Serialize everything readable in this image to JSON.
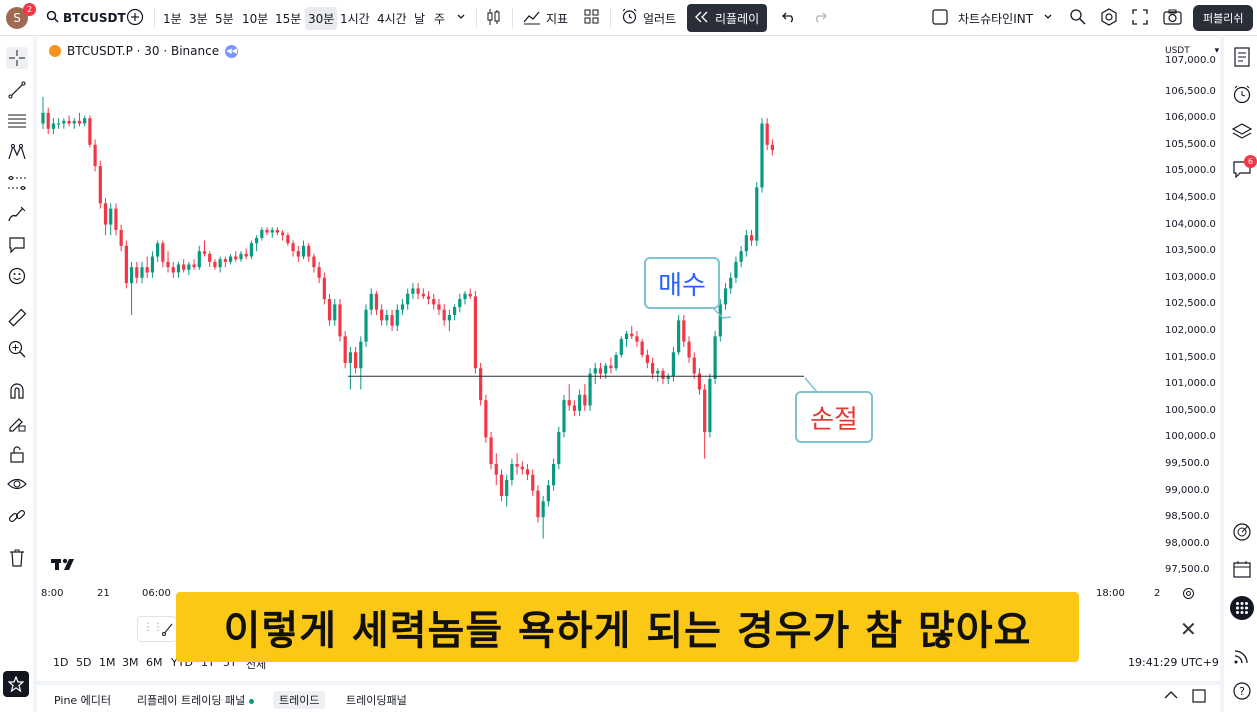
{
  "topbar": {
    "avatar_letter": "S",
    "avatar_badge": "2",
    "symbol": "BTCUSDT",
    "intervals": [
      "1분",
      "3분",
      "5분",
      "10분",
      "15분",
      "30분",
      "1시간",
      "4시간",
      "날",
      "주"
    ],
    "active_interval": "30분",
    "indicators_label": "지표",
    "alert_label": "얼러트",
    "replay_label": "리플레이",
    "layout_name": "차트슈타인INT",
    "publish_label": "퍼블리쉬"
  },
  "legend": {
    "title": "BTCUSDT.P · 30 · Binance"
  },
  "price_axis": {
    "currency": "USDT",
    "labels": [
      "107,000.0",
      "106,500.0",
      "106,000.0",
      "105,500.0",
      "105,000.0",
      "104,500.0",
      "104,000.0",
      "103,500.0",
      "103,000.0",
      "102,500.0",
      "102,000.0",
      "101,500.0",
      "101,000.0",
      "100,500.0",
      "100,000.0",
      "99,500.0",
      "99,000.0",
      "98,500.0",
      "98,000.0",
      "97,500.0"
    ]
  },
  "time_axis": {
    "labels": [
      "8:00",
      "21",
      "06:00",
      "18:00",
      "2"
    ]
  },
  "range_bar": {
    "ranges": [
      "1D",
      "5D",
      "1M",
      "3M",
      "6M",
      "YTD",
      "1Y",
      "5Y",
      "전체"
    ],
    "clock": "19:41:29 UTC+9"
  },
  "bottom_tabs": [
    "Pine 에디터",
    "리플레이 트레이딩 패널",
    "트레이드",
    "트레이딩패널"
  ],
  "right_badge": "6",
  "annotations": {
    "buy": "매수",
    "stop": "손절"
  },
  "subtitle": "이렇게 세력놈들 욕하게 되는 경우가 참 많아요",
  "colors": {
    "up": "#089981",
    "down": "#f23645",
    "subtitle_bg": "#fbc816",
    "buy_text": "#2962ff",
    "stop_text": "#e53935"
  },
  "chart_data": {
    "type": "candlestick",
    "title": "BTCUSDT.P · 30 · Binance",
    "ylim": [
      97300,
      107000
    ],
    "horizontal_line": 101150,
    "ohlc": [
      [
        105900,
        106400,
        105800,
        106100
      ],
      [
        106100,
        106200,
        105700,
        105800
      ],
      [
        105800,
        106000,
        105700,
        105900
      ],
      [
        105900,
        106000,
        105800,
        105900
      ],
      [
        105900,
        106000,
        105800,
        105950
      ],
      [
        105950,
        106050,
        105850,
        105900
      ],
      [
        105900,
        106000,
        105800,
        105950
      ],
      [
        105950,
        106100,
        105850,
        105900
      ],
      [
        105900,
        106050,
        105850,
        106000
      ],
      [
        106000,
        106050,
        105450,
        105500
      ],
      [
        105500,
        105600,
        105000,
        105100
      ],
      [
        105100,
        105200,
        104300,
        104400
      ],
      [
        104400,
        104500,
        103800,
        104000
      ],
      [
        104000,
        104400,
        103800,
        104300
      ],
      [
        104300,
        104400,
        103800,
        103900
      ],
      [
        103900,
        104000,
        103500,
        103600
      ],
      [
        103600,
        103700,
        102800,
        102900
      ],
      [
        102900,
        103300,
        102300,
        103200
      ],
      [
        103200,
        103300,
        102900,
        103000
      ],
      [
        103000,
        103300,
        102900,
        103200
      ],
      [
        103200,
        103400,
        103000,
        103100
      ],
      [
        103100,
        103500,
        103000,
        103400
      ],
      [
        103400,
        103700,
        103300,
        103650
      ],
      [
        103650,
        103700,
        103200,
        103300
      ],
      [
        103300,
        103500,
        103100,
        103200
      ],
      [
        103200,
        103300,
        103000,
        103100
      ],
      [
        103100,
        103300,
        103000,
        103250
      ],
      [
        103250,
        103350,
        103100,
        103150
      ],
      [
        103150,
        103300,
        103050,
        103250
      ],
      [
        103250,
        103350,
        103150,
        103200
      ],
      [
        103200,
        103600,
        103150,
        103500
      ],
      [
        103500,
        103700,
        103400,
        103450
      ],
      [
        103450,
        103500,
        103200,
        103300
      ],
      [
        103300,
        103350,
        103150,
        103200
      ],
      [
        103200,
        103400,
        103100,
        103350
      ],
      [
        103350,
        103400,
        103200,
        103300
      ],
      [
        103300,
        103450,
        103250,
        103400
      ],
      [
        103400,
        103500,
        103300,
        103350
      ],
      [
        103350,
        103500,
        103300,
        103450
      ],
      [
        103450,
        103550,
        103350,
        103400
      ],
      [
        103400,
        103700,
        103350,
        103650
      ],
      [
        103650,
        103800,
        103500,
        103750
      ],
      [
        103750,
        103950,
        103700,
        103900
      ],
      [
        103900,
        103950,
        103800,
        103850
      ],
      [
        103850,
        103950,
        103750,
        103900
      ],
      [
        103900,
        103950,
        103800,
        103850
      ],
      [
        103850,
        103900,
        103700,
        103800
      ],
      [
        103800,
        103850,
        103600,
        103650
      ],
      [
        103650,
        103700,
        103400,
        103500
      ],
      [
        103500,
        103600,
        103300,
        103400
      ],
      [
        103400,
        103700,
        103350,
        103600
      ],
      [
        103600,
        103650,
        103300,
        103400
      ],
      [
        103400,
        103450,
        103100,
        103200
      ],
      [
        103200,
        103300,
        102900,
        103000
      ],
      [
        103000,
        103100,
        102500,
        102600
      ],
      [
        102600,
        102700,
        102100,
        102200
      ],
      [
        102200,
        102600,
        102100,
        102500
      ],
      [
        102500,
        102600,
        101800,
        101900
      ],
      [
        101900,
        102000,
        101300,
        101400
      ],
      [
        101400,
        101700,
        100900,
        101600
      ],
      [
        101600,
        101700,
        101200,
        101300
      ],
      [
        101300,
        101900,
        100900,
        101800
      ],
      [
        101800,
        102500,
        101700,
        102400
      ],
      [
        102400,
        102800,
        102300,
        102700
      ],
      [
        102700,
        102750,
        102300,
        102400
      ],
      [
        102400,
        102500,
        102100,
        102200
      ],
      [
        102200,
        102400,
        102100,
        102300
      ],
      [
        102300,
        102400,
        102000,
        102100
      ],
      [
        102100,
        102500,
        102000,
        102400
      ],
      [
        102400,
        102600,
        102300,
        102500
      ],
      [
        102500,
        102800,
        102400,
        102700
      ],
      [
        102700,
        102900,
        102600,
        102800
      ],
      [
        102800,
        102900,
        102600,
        102700
      ],
      [
        102700,
        102800,
        102600,
        102650
      ],
      [
        102650,
        102750,
        102500,
        102600
      ],
      [
        102600,
        102700,
        102400,
        102500
      ],
      [
        102500,
        102600,
        102300,
        102400
      ],
      [
        102400,
        102500,
        102100,
        102200
      ],
      [
        102200,
        102400,
        102000,
        102300
      ],
      [
        102300,
        102500,
        102200,
        102450
      ],
      [
        102450,
        102700,
        102350,
        102600
      ],
      [
        102600,
        102750,
        102500,
        102700
      ],
      [
        102700,
        102800,
        102600,
        102650
      ],
      [
        102650,
        102750,
        101200,
        101300
      ],
      [
        101300,
        101400,
        100600,
        100700
      ],
      [
        100700,
        100800,
        99900,
        100000
      ],
      [
        100000,
        100100,
        99400,
        99500
      ],
      [
        99500,
        99700,
        99100,
        99300
      ],
      [
        99300,
        99400,
        98800,
        98900
      ],
      [
        98900,
        99300,
        98700,
        99200
      ],
      [
        99200,
        99600,
        99100,
        99500
      ],
      [
        99500,
        99700,
        99300,
        99450
      ],
      [
        99450,
        99550,
        99300,
        99400
      ],
      [
        99400,
        99500,
        99200,
        99300
      ],
      [
        99300,
        99400,
        98900,
        99000
      ],
      [
        99000,
        99100,
        98400,
        98500
      ],
      [
        98500,
        98900,
        98100,
        98800
      ],
      [
        98800,
        99200,
        98700,
        99100
      ],
      [
        99100,
        99600,
        99000,
        99500
      ],
      [
        99500,
        100200,
        99400,
        100100
      ],
      [
        100100,
        100800,
        100000,
        100700
      ],
      [
        100700,
        101000,
        100500,
        100600
      ],
      [
        100600,
        100700,
        100400,
        100500
      ],
      [
        100500,
        100900,
        100400,
        100800
      ],
      [
        100800,
        101000,
        100500,
        100600
      ],
      [
        100600,
        101300,
        100500,
        101200
      ],
      [
        101200,
        101400,
        101000,
        101300
      ],
      [
        101300,
        101400,
        101100,
        101200
      ],
      [
        101200,
        101400,
        101100,
        101350
      ],
      [
        101350,
        101500,
        101200,
        101300
      ],
      [
        101300,
        101600,
        101250,
        101550
      ],
      [
        101550,
        101900,
        101500,
        101850
      ],
      [
        101850,
        102000,
        101700,
        101950
      ],
      [
        101950,
        102100,
        101850,
        101900
      ],
      [
        101900,
        102000,
        101700,
        101800
      ],
      [
        101800,
        101850,
        101500,
        101550
      ],
      [
        101550,
        101650,
        101300,
        101400
      ],
      [
        101400,
        101500,
        101100,
        101200
      ],
      [
        101200,
        101300,
        101050,
        101250
      ],
      [
        101250,
        101300,
        101000,
        101100
      ],
      [
        101100,
        101200,
        101000,
        101150
      ],
      [
        101150,
        101700,
        101050,
        101600
      ],
      [
        101600,
        102300,
        101550,
        102200
      ],
      [
        102200,
        102300,
        101700,
        101800
      ],
      [
        101800,
        101900,
        101400,
        101500
      ],
      [
        101500,
        101600,
        101100,
        101200
      ],
      [
        101200,
        101300,
        100800,
        100900
      ],
      [
        100900,
        101000,
        99600,
        100100
      ],
      [
        100100,
        101200,
        100000,
        101100
      ],
      [
        101100,
        102000,
        101000,
        101900
      ],
      [
        101900,
        102600,
        101800,
        102500
      ],
      [
        102500,
        102900,
        102400,
        102800
      ],
      [
        102800,
        103100,
        102700,
        103000
      ],
      [
        103000,
        103400,
        102900,
        103300
      ],
      [
        103300,
        103600,
        103200,
        103500
      ],
      [
        103500,
        103900,
        103400,
        103800
      ],
      [
        103800,
        103900,
        103600,
        103700
      ],
      [
        103700,
        104800,
        103600,
        104700
      ],
      [
        104700,
        106000,
        104600,
        105900
      ],
      [
        105900,
        106000,
        105400,
        105500
      ],
      [
        105500,
        105600,
        105300,
        105400
      ]
    ]
  }
}
